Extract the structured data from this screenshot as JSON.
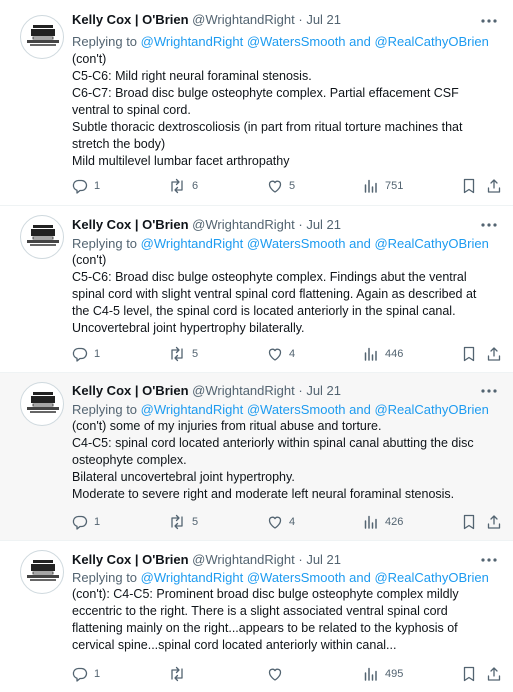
{
  "tweets": [
    {
      "author_name": "Kelly Cox | O'Brien",
      "handle": "@WrightandRight",
      "date": "Jul 21",
      "replying_prefix": "Replying to ",
      "replying_1": "@WrightandRight",
      "replying_2": "@WatersSmooth",
      "replying_and": " and ",
      "replying_3": "@RealCathyOBrien",
      "lines": [
        "(con't)",
        "C5-C6: Mild right neural foraminal stenosis.",
        "C6-C7: Broad disc bulge osteophyte complex. Partial effacement CSF",
        "ventral to spinal cord.",
        "Subtle thoracic dextroscoliosis (in part from ritual torture machines that",
        "stretch the body)",
        "Mild multilevel lumbar facet arthropathy"
      ],
      "replies": "1",
      "reposts": "6",
      "likes": "5",
      "views": "751"
    },
    {
      "author_name": "Kelly Cox | O'Brien",
      "handle": "@WrightandRight",
      "date": "Jul 21",
      "replying_prefix": "Replying to ",
      "replying_1": "@WrightandRight",
      "replying_2": "@WatersSmooth",
      "replying_and": " and ",
      "replying_3": "@RealCathyOBrien",
      "lines": [
        "(con't)",
        "C5-C6: Broad disc bulge osteophyte complex. Findings abut the ventral",
        "spinal cord with slight ventral spinal cord flattening. Again as described at",
        "the C4-5 level, the spinal cord is located anteriorly in the spinal canal.",
        "Uncovertebral joint hypertrophy bilaterally."
      ],
      "replies": "1",
      "reposts": "5",
      "likes": "4",
      "views": "446"
    },
    {
      "author_name": "Kelly Cox | O'Brien",
      "handle": "@WrightandRight",
      "date": "Jul 21",
      "replying_prefix": "Replying to ",
      "replying_1": "@WrightandRight",
      "replying_2": "@WatersSmooth",
      "replying_and": " and ",
      "replying_3": "@RealCathyOBrien",
      "lines": [
        "(con't) some of my injuries from ritual abuse and torture.",
        "C4-C5: spinal cord located anteriorly within spinal canal abutting the disc",
        "osteophyte complex.",
        "Bilateral uncovertebral joint hypertrophy.",
        "Moderate to severe right and moderate left neural foraminal stenosis."
      ],
      "replies": "1",
      "reposts": "5",
      "likes": "4",
      "views": "426"
    },
    {
      "author_name": "Kelly Cox | O'Brien",
      "handle": "@WrightandRight",
      "date": "Jul 21",
      "replying_prefix": "Replying to ",
      "replying_1": "@WrightandRight",
      "replying_2": "@WatersSmooth",
      "replying_and": " and ",
      "replying_3": "@RealCathyOBrien",
      "lines": [
        "(con't): C4-C5: Prominent broad disc bulge osteophyte complex mildly",
        "eccentric to the right. There is a slight associated ventral spinal cord",
        "flattening mainly on the right...appears to be related to the kyphosis of",
        "cervical spine...spinal cord located anteriorly within canal..."
      ],
      "replies": "1",
      "reposts": "",
      "likes": "",
      "views": "495"
    }
  ],
  "colors": {
    "link": "#1d9bf0",
    "muted": "#536471",
    "text": "#0f1419",
    "highlight_bg": "#f7f7f7"
  }
}
